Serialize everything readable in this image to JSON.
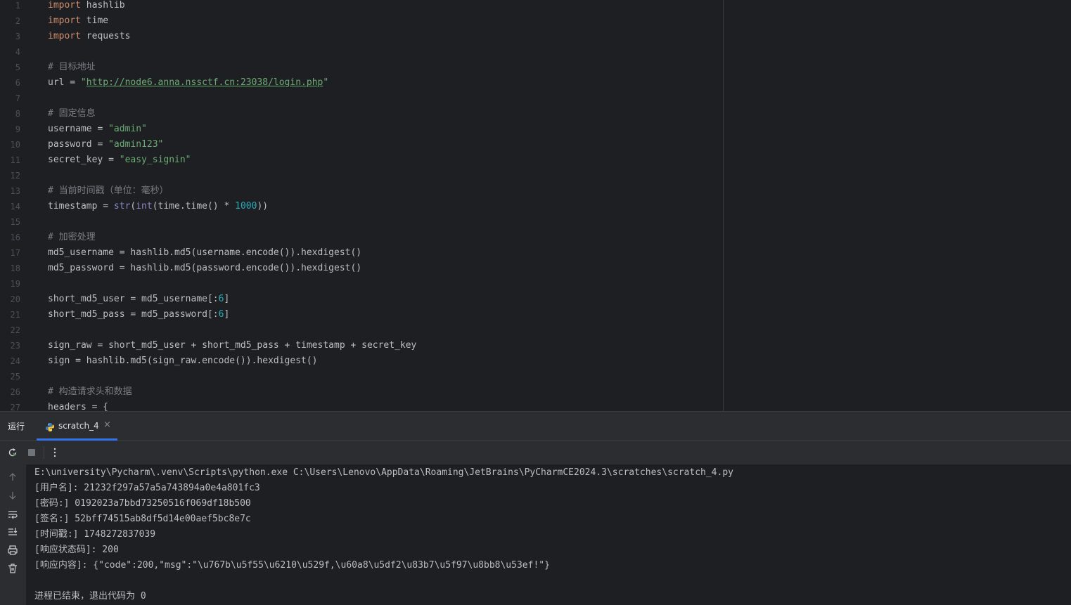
{
  "editor": {
    "line_numbers": [
      "1",
      "2",
      "3",
      "4",
      "5",
      "6",
      "7",
      "8",
      "9",
      "10",
      "11",
      "12",
      "13",
      "14",
      "15",
      "16",
      "17",
      "18",
      "19",
      "20",
      "21",
      "22",
      "23",
      "24",
      "25",
      "26",
      "27"
    ],
    "lines": [
      [
        {
          "t": "import",
          "c": "kw"
        },
        {
          "t": " hashlib",
          "c": ""
        }
      ],
      [
        {
          "t": "import",
          "c": "kw"
        },
        {
          "t": " time",
          "c": ""
        }
      ],
      [
        {
          "t": "import",
          "c": "kw"
        },
        {
          "t": " requests",
          "c": ""
        }
      ],
      [],
      [
        {
          "t": "# 目标地址",
          "c": "com"
        }
      ],
      [
        {
          "t": "url = ",
          "c": ""
        },
        {
          "t": "\"",
          "c": "str"
        },
        {
          "t": "http://node6.anna.nssctf.cn:23038/login.php",
          "c": "url"
        },
        {
          "t": "\"",
          "c": "str"
        }
      ],
      [],
      [
        {
          "t": "# 固定信息",
          "c": "com"
        }
      ],
      [
        {
          "t": "username = ",
          "c": ""
        },
        {
          "t": "\"admin\"",
          "c": "str"
        }
      ],
      [
        {
          "t": "password = ",
          "c": ""
        },
        {
          "t": "\"admin123\"",
          "c": "str"
        }
      ],
      [
        {
          "t": "secret_key = ",
          "c": ""
        },
        {
          "t": "\"easy_signin\"",
          "c": "str"
        }
      ],
      [],
      [
        {
          "t": "# 当前时间戳（单位：毫秒）",
          "c": "com"
        }
      ],
      [
        {
          "t": "timestamp = ",
          "c": ""
        },
        {
          "t": "str",
          "c": "bi"
        },
        {
          "t": "(",
          "c": ""
        },
        {
          "t": "int",
          "c": "bi"
        },
        {
          "t": "(time.time() * ",
          "c": ""
        },
        {
          "t": "1000",
          "c": "num"
        },
        {
          "t": "))",
          "c": ""
        }
      ],
      [],
      [
        {
          "t": "# 加密处理",
          "c": "com"
        }
      ],
      [
        {
          "t": "md5_username = hashlib.md5(username.encode()).hexdigest()",
          "c": ""
        }
      ],
      [
        {
          "t": "md5_password = hashlib.md5(password.encode()).hexdigest()",
          "c": ""
        }
      ],
      [],
      [
        {
          "t": "short_md5_user = md5_username[:",
          "c": ""
        },
        {
          "t": "6",
          "c": "num"
        },
        {
          "t": "]",
          "c": ""
        }
      ],
      [
        {
          "t": "short_md5_pass = md5_password[:",
          "c": ""
        },
        {
          "t": "6",
          "c": "num"
        },
        {
          "t": "]",
          "c": ""
        }
      ],
      [],
      [
        {
          "t": "sign_raw = short_md5_user + short_md5_pass + timestamp + secret_key",
          "c": ""
        }
      ],
      [
        {
          "t": "sign = hashlib.md5(sign_raw.encode()).hexdigest()",
          "c": ""
        }
      ],
      [],
      [
        {
          "t": "# 构造请求头和数据",
          "c": "com"
        }
      ],
      [
        {
          "t": "headers = {",
          "c": ""
        }
      ]
    ]
  },
  "run_panel": {
    "title": "运行",
    "tab_label": "scratch_4",
    "tab_close": "×"
  },
  "toolbar": {
    "rerun_icon": "rerun-icon",
    "stop_icon": "stop-icon",
    "more_icon": "more-vertical-icon"
  },
  "sidebar_icons": [
    "arrow-up-icon",
    "arrow-down-icon",
    "soft-wrap-icon",
    "scroll-to-end-icon",
    "print-icon",
    "trash-icon"
  ],
  "console": {
    "lines": [
      "E:\\university\\Pycharm\\.venv\\Scripts\\python.exe C:\\Users\\Lenovo\\AppData\\Roaming\\JetBrains\\PyCharmCE2024.3\\scratches\\scratch_4.py",
      "[用户名]: 21232f297a57a5a743894a0e4a801fc3",
      "[密码:] 0192023a7bbd73250516f069df18b500",
      "[签名:] 52bff74515ab8df5d14e00aef5bc8e7c",
      "[时间戳:] 1748272837039",
      "[响应状态码]: 200",
      "[响应内容]: {\"code\":200,\"msg\":\"\\u767b\\u5f55\\u6210\\u529f,\\u60a8\\u5df2\\u83b7\\u5f97\\u8bb8\\u53ef!\"}",
      "",
      "进程已结束，退出代码为 0"
    ]
  },
  "colors": {
    "background": "#1e1f22",
    "panel": "#2b2d30",
    "keyword": "#cf8e6d",
    "string": "#6aab73",
    "comment": "#7a7e85",
    "number": "#2aacb8",
    "accent": "#3574f0"
  }
}
